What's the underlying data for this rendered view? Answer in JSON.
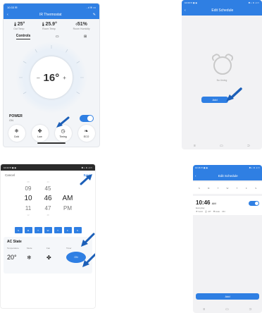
{
  "colors": {
    "accent": "#2f7fe3"
  },
  "screen1": {
    "status_time": "10:33 ✉",
    "status_icons": "..ıl ≋ ▭",
    "header_title": "IR Thermostat",
    "back_icon": "chevron-left-icon",
    "edit_icon": "pencil-icon",
    "stats": [
      {
        "icon": "thermometer-icon",
        "value": "25°",
        "label": "Out Temp"
      },
      {
        "icon": "thermometer-icon",
        "value": "25.9°",
        "label": "Room Temp"
      },
      {
        "icon": "droplet-icon",
        "value": "51%",
        "label": "Room Humidity"
      }
    ],
    "tabs": [
      {
        "label": "Controls",
        "active": true
      },
      {
        "label": "▭",
        "active": false
      },
      {
        "label": "⊞",
        "active": false
      }
    ],
    "dial": {
      "minus": "–",
      "temp": "16°",
      "plus": "+"
    },
    "power": {
      "label": "POWER",
      "state": "ON",
      "on": true
    },
    "modes": [
      {
        "icon": "snowflake-icon",
        "glyph": "❄",
        "label": "Cold"
      },
      {
        "icon": "fan-icon",
        "glyph": "✤",
        "label": "Low"
      },
      {
        "icon": "clock-icon",
        "glyph": "◷",
        "label": "Timing"
      },
      {
        "icon": "leaf-icon",
        "glyph": "❧",
        "label": "ECO"
      }
    ]
  },
  "screen2": {
    "status_time": "10:39 ✉ ▣ ◉",
    "status_icons": "✱ ◐ ≋ .ıl ▭",
    "header_title": "Edit Schedule",
    "back_icon": "chevron-left-icon",
    "empty_text": "No timing",
    "add_label": "Add",
    "nav": [
      "≡",
      "▭",
      "⊃"
    ]
  },
  "screen3": {
    "status_time": "10:44 ✉ ▣ ◉",
    "status_icons": "✱ ◐ ≋ .ıl ▭",
    "cancel_label": "Cancel",
    "save_label": "Save",
    "picker": {
      "faint_top": [
        "08",
        "44"
      ],
      "above": [
        "09",
        "45"
      ],
      "selected": [
        "10",
        "46",
        "AM"
      ],
      "below": [
        "11",
        "47",
        "PM"
      ],
      "faint_bottom": [
        "12",
        "48"
      ]
    },
    "days": [
      "S",
      "M",
      "T",
      "W",
      "T",
      "F",
      "S"
    ],
    "ac_state": {
      "title": "AC State",
      "labels": [
        "Temperature",
        "Mode",
        "Fan",
        "Timer"
      ],
      "temp": "20°",
      "mode_icon": "snowflake-icon",
      "fan_icon": "fan-icon",
      "timer": "ON"
    }
  },
  "screen4": {
    "status_time": "10:46 ✉ ▣ ◉",
    "status_icons": "✱ ◐ ≋ .ıl ▭",
    "header_title": "Edit Schedule",
    "back_icon": "chevron-left-icon",
    "days": [
      "S",
      "M",
      "T",
      "W",
      "T",
      "F",
      "S"
    ],
    "entry": {
      "time": "10:46",
      "ampm": "AM",
      "repeat": "Everyday",
      "mode": "❄ Cold",
      "temp": "🌡 20°",
      "fan": "✤ Auto",
      "power": "ON",
      "enabled": true
    },
    "add_label": "Add",
    "nav": [
      "≡",
      "▭",
      "⊃"
    ]
  }
}
